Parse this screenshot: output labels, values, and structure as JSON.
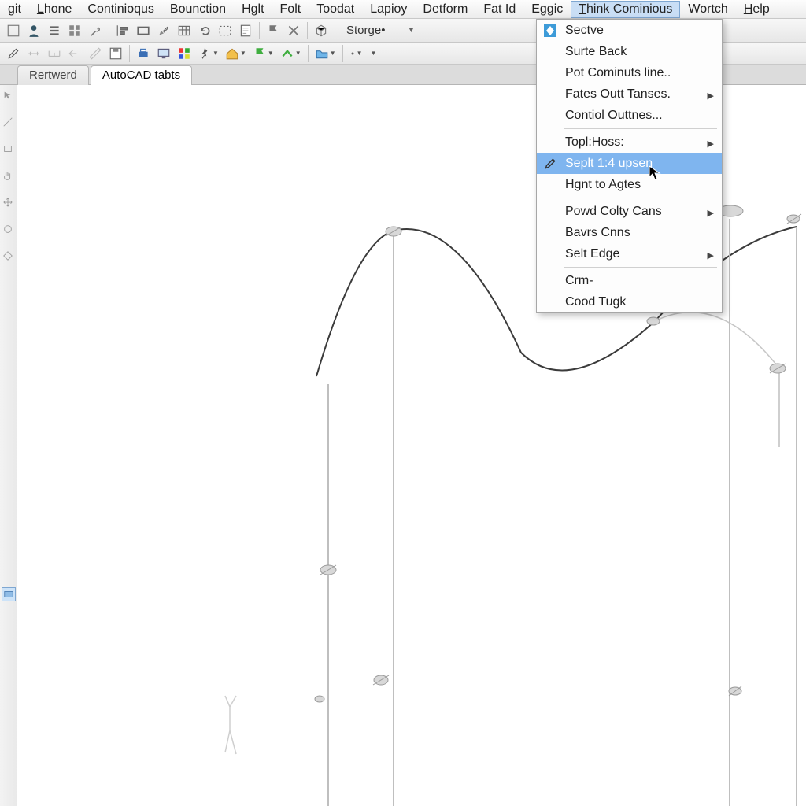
{
  "menubar": [
    {
      "label": "git",
      "u": ""
    },
    {
      "label": "Lhone",
      "u": "L"
    },
    {
      "label": "Continioqus",
      "u": ""
    },
    {
      "label": "Bounction",
      "u": ""
    },
    {
      "label": "Hglt",
      "u": ""
    },
    {
      "label": "Folt",
      "u": ""
    },
    {
      "label": "Toodat",
      "u": ""
    },
    {
      "label": "Lapioy",
      "u": ""
    },
    {
      "label": "Detform",
      "u": ""
    },
    {
      "label": "Fat Id",
      "u": ""
    },
    {
      "label": "Eggic",
      "u": ""
    },
    {
      "label": "Think Cominious",
      "u": "T",
      "open": true
    },
    {
      "label": "Wortch",
      "u": ""
    },
    {
      "label": "Help",
      "u": "H"
    }
  ],
  "toolbar1": {
    "combo_label": "Storge•"
  },
  "tabs": [
    {
      "label": "Rertwerd",
      "active": false
    },
    {
      "label": "AutoCAD tabts",
      "active": true
    }
  ],
  "dropdown": {
    "items": [
      {
        "label": "Sectve",
        "icon": "diamond-blue"
      },
      {
        "label": "Surte Back"
      },
      {
        "label": "Pot Cominuts line.."
      },
      {
        "label": "Fates Outt Tanses.",
        "sub": true
      },
      {
        "label": "Contiol Outtnes..."
      },
      {
        "sep": true
      },
      {
        "label": "Topl:Hoss:",
        "sub": true
      },
      {
        "label": "Seplt 1:4 upsen",
        "hl": true,
        "icon": "pencil"
      },
      {
        "label": "Hgnt to Agtes"
      },
      {
        "sep": true
      },
      {
        "label": "Powd Colty Cans",
        "sub": true
      },
      {
        "label": "Bavrs Cnns"
      },
      {
        "label": "Selt Edge",
        "sub": true
      },
      {
        "sep": true
      },
      {
        "label": "Crm-"
      },
      {
        "label": "Cood Tugk"
      }
    ]
  }
}
